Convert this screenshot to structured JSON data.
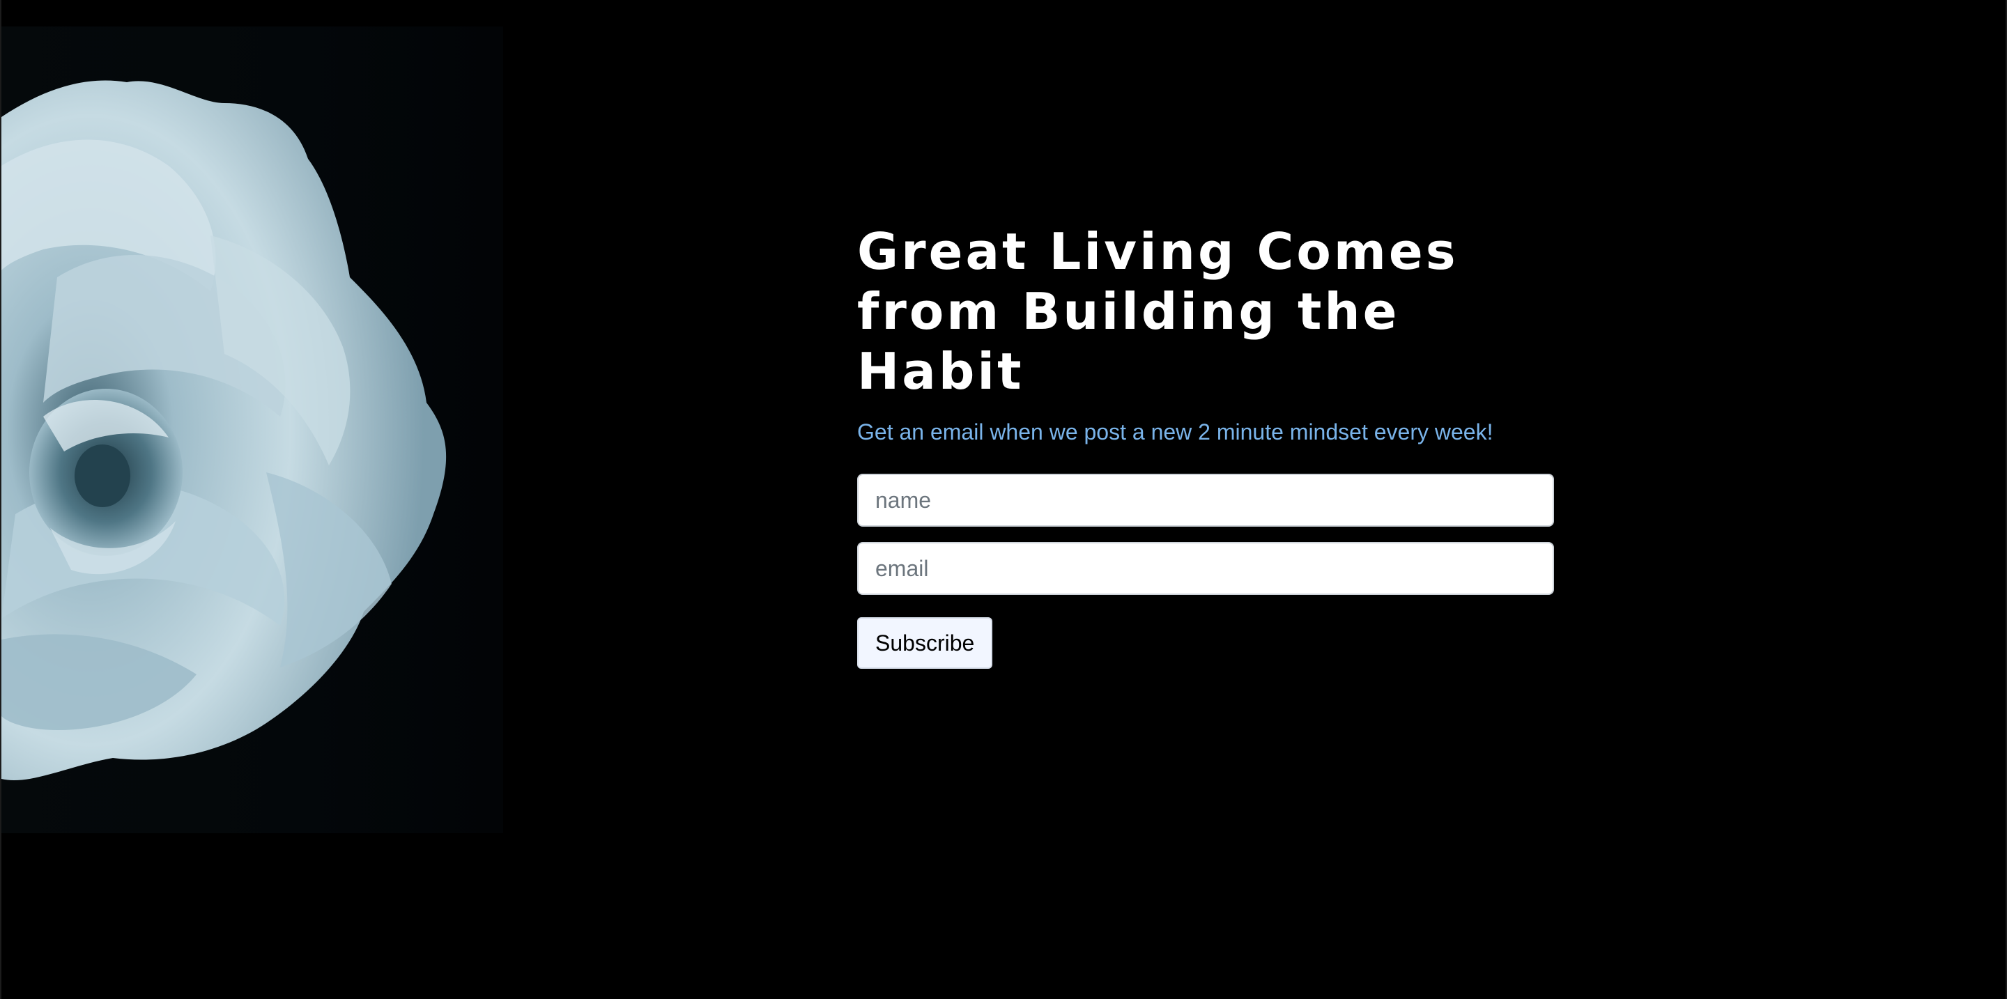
{
  "hero": {
    "image_name": "white-rose-photo",
    "colors": {
      "background": "#000000",
      "photo_dark": "#03070a",
      "petal_light": "#c9dde5",
      "petal_mid": "#8fb1bf",
      "petal_shadow": "#3d6170"
    }
  },
  "signup": {
    "headline": "Great Living Comes from Building the Habit",
    "subtitle": "Get an email when we post a new 2 minute mindset every week!",
    "name_placeholder": "name",
    "email_placeholder": "email",
    "subscribe_label": "Subscribe",
    "colors": {
      "headline": "#ffffff",
      "subtitle": "#7ab4ea",
      "button_bg": "#f2f6ff"
    }
  }
}
